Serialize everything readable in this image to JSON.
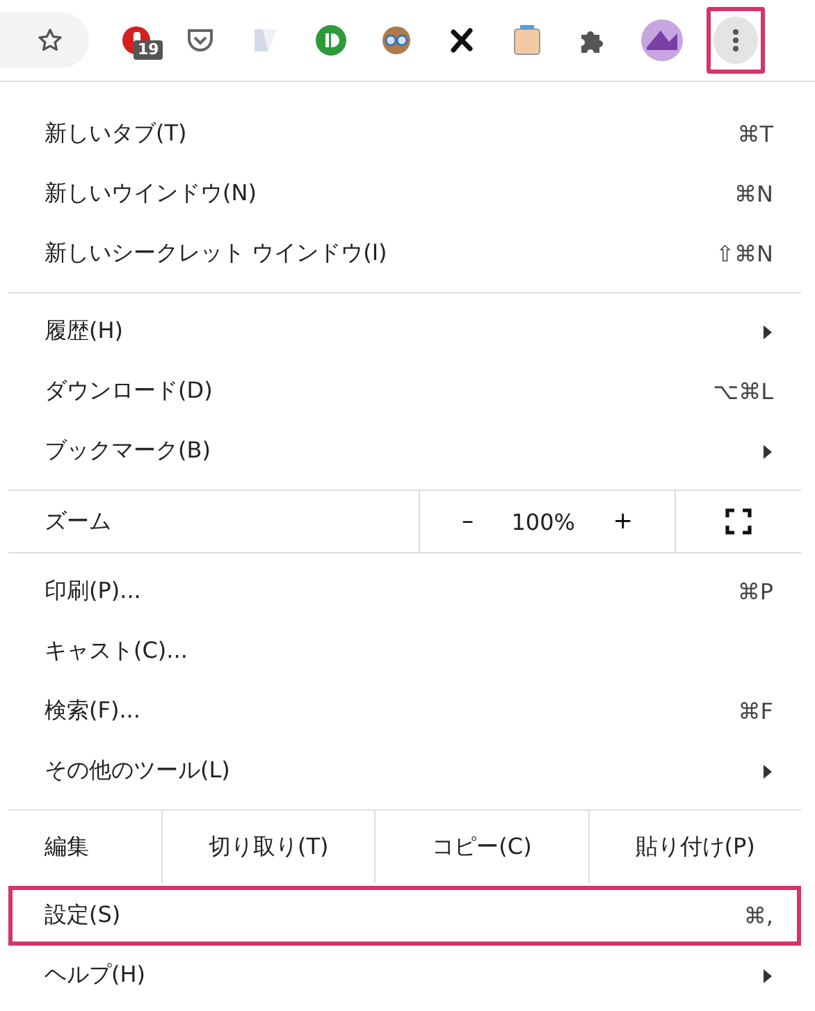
{
  "toolbar": {
    "extension_badge": "19",
    "menu_button": {
      "highlighted": true
    }
  },
  "menu": {
    "groups": [
      {
        "rows": [
          {
            "kind": "item",
            "label": "新しいタブ(T)",
            "shortcut": "⌘T",
            "submenu": false,
            "highlighted": false
          },
          {
            "kind": "item",
            "label": "新しいウインドウ(N)",
            "shortcut": "⌘N",
            "submenu": false,
            "highlighted": false
          },
          {
            "kind": "item",
            "label": "新しいシークレット ウインドウ(I)",
            "shortcut": "⇧⌘N",
            "submenu": false,
            "highlighted": false
          }
        ]
      },
      {
        "rows": [
          {
            "kind": "item",
            "label": "履歴(H)",
            "submenu": true,
            "highlighted": false
          },
          {
            "kind": "item",
            "label": "ダウンロード(D)",
            "shortcut": "⌥⌘L",
            "submenu": false,
            "highlighted": false
          },
          {
            "kind": "item",
            "label": "ブックマーク(B)",
            "submenu": true,
            "highlighted": false
          }
        ]
      },
      {
        "rows": [
          {
            "kind": "zoom",
            "label": "ズーム",
            "minus": "–",
            "value": "100%",
            "plus": "+"
          }
        ]
      },
      {
        "rows": [
          {
            "kind": "item",
            "label": "印刷(P)...",
            "shortcut": "⌘P",
            "submenu": false,
            "highlighted": false
          },
          {
            "kind": "item",
            "label": "キャスト(C)...",
            "submenu": false,
            "highlighted": false
          },
          {
            "kind": "item",
            "label": "検索(F)...",
            "shortcut": "⌘F",
            "submenu": false,
            "highlighted": false
          },
          {
            "kind": "item",
            "label": "その他のツール(L)",
            "submenu": true,
            "highlighted": false
          }
        ]
      },
      {
        "rows": [
          {
            "kind": "edit",
            "label": "編集",
            "actions": [
              "切り取り(T)",
              "コピー(C)",
              "貼り付け(P)"
            ]
          },
          {
            "kind": "item",
            "label": "設定(S)",
            "shortcut": "⌘,",
            "submenu": false,
            "highlighted": true
          },
          {
            "kind": "item",
            "label": "ヘルプ(H)",
            "submenu": true,
            "highlighted": false
          }
        ]
      }
    ]
  }
}
